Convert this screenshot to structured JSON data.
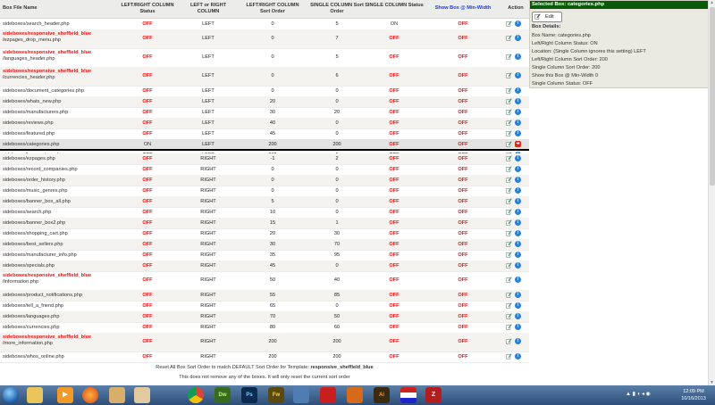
{
  "headers": {
    "file": "Box File Name",
    "lr_status": "LEFT/RIGHT COLUMN Status",
    "lr_column": "LEFT or RIGHT COLUMN",
    "lr_sort": "LEFT/RIGHT COLUMN Sort Order",
    "single_sort": "SINGLE COLUMN Sort Order",
    "single_status": "SINGLE COLUMN Status",
    "show_min": "Show Box @ Min-Width",
    "action": "Action"
  },
  "rows": [
    {
      "name": "sideboxes/search_header.php",
      "lr_status": "OFF",
      "column": "LEFT",
      "lr_sort": "0",
      "single_sort": "5",
      "single_status": "ON",
      "show": "OFF"
    },
    {
      "name_t1": "sideboxes/responsive_sheffield_blue",
      "name_t2": "/ezpages_drop_menu.php",
      "lr_status": "OFF",
      "column": "LEFT",
      "lr_sort": "0",
      "single_sort": "7",
      "single_status": "OFF",
      "show": "OFF"
    },
    {
      "name_t1": "sideboxes/responsive_sheffield_blue",
      "name_t2": "/languages_header.php",
      "lr_status": "OFF",
      "column": "LEFT",
      "lr_sort": "0",
      "single_sort": "5",
      "single_status": "OFF",
      "show": "OFF"
    },
    {
      "name_t1": "sideboxes/responsive_sheffield_blue",
      "name_t2": "/currencies_header.php",
      "lr_status": "OFF",
      "column": "LEFT",
      "lr_sort": "0",
      "single_sort": "6",
      "single_status": "OFF",
      "show": "OFF"
    },
    {
      "name": "sideboxes/document_categories.php",
      "lr_status": "OFF",
      "column": "LEFT",
      "lr_sort": "0",
      "single_sort": "0",
      "single_status": "OFF",
      "show": "OFF"
    },
    {
      "name": "sideboxes/whats_new.php",
      "lr_status": "OFF",
      "column": "LEFT",
      "lr_sort": "20",
      "single_sort": "0",
      "single_status": "OFF",
      "show": "OFF"
    },
    {
      "name": "sideboxes/manufacturers.php",
      "lr_status": "OFF",
      "column": "LEFT",
      "lr_sort": "30",
      "single_sort": "20",
      "single_status": "OFF",
      "show": "OFF"
    },
    {
      "name": "sideboxes/reviews.php",
      "lr_status": "OFF",
      "column": "LEFT",
      "lr_sort": "40",
      "single_sort": "0",
      "single_status": "OFF",
      "show": "OFF"
    },
    {
      "name": "sideboxes/featured.php",
      "lr_status": "OFF",
      "column": "LEFT",
      "lr_sort": "45",
      "single_sort": "0",
      "single_status": "OFF",
      "show": "OFF"
    },
    {
      "name": "sideboxes/categories.php",
      "lr_status": "ON",
      "column": "LEFT",
      "lr_sort": "200",
      "single_sort": "200",
      "single_status": "OFF",
      "show": "OFF",
      "selected": true
    },
    {
      "name": "sideboxes/banner_box.php",
      "lr_status": "OFF",
      "column": "LEFT",
      "lr_sort": "300",
      "single_sort": "1",
      "single_status": "OFF",
      "show": "OFF"
    },
    {
      "name": "sideboxes/ezpages.php",
      "lr_status": "OFF",
      "column": "RIGHT",
      "lr_sort": "-1",
      "single_sort": "2",
      "single_status": "OFF",
      "show": "OFF"
    },
    {
      "name": "sideboxes/record_companies.php",
      "lr_status": "OFF",
      "column": "RIGHT",
      "lr_sort": "0",
      "single_sort": "0",
      "single_status": "OFF",
      "show": "OFF"
    },
    {
      "name": "sideboxes/order_history.php",
      "lr_status": "OFF",
      "column": "RIGHT",
      "lr_sort": "0",
      "single_sort": "0",
      "single_status": "OFF",
      "show": "OFF"
    },
    {
      "name": "sideboxes/music_genres.php",
      "lr_status": "OFF",
      "column": "RIGHT",
      "lr_sort": "0",
      "single_sort": "0",
      "single_status": "OFF",
      "show": "OFF"
    },
    {
      "name": "sideboxes/banner_box_all.php",
      "lr_status": "OFF",
      "column": "RIGHT",
      "lr_sort": "5",
      "single_sort": "0",
      "single_status": "OFF",
      "show": "OFF"
    },
    {
      "name": "sideboxes/search.php",
      "lr_status": "OFF",
      "column": "RIGHT",
      "lr_sort": "10",
      "single_sort": "0",
      "single_status": "OFF",
      "show": "OFF"
    },
    {
      "name": "sideboxes/banner_box2.php",
      "lr_status": "OFF",
      "column": "RIGHT",
      "lr_sort": "15",
      "single_sort": "1",
      "single_status": "OFF",
      "show": "OFF"
    },
    {
      "name": "sideboxes/shopping_cart.php",
      "lr_status": "OFF",
      "column": "RIGHT",
      "lr_sort": "20",
      "single_sort": "30",
      "single_status": "OFF",
      "show": "OFF"
    },
    {
      "name": "sideboxes/best_sellers.php",
      "lr_status": "OFF",
      "column": "RIGHT",
      "lr_sort": "30",
      "single_sort": "70",
      "single_status": "OFF",
      "show": "OFF"
    },
    {
      "name": "sideboxes/manufacturer_info.php",
      "lr_status": "OFF",
      "column": "RIGHT",
      "lr_sort": "35",
      "single_sort": "95",
      "single_status": "OFF",
      "show": "OFF"
    },
    {
      "name": "sideboxes/specials.php",
      "lr_status": "OFF",
      "column": "RIGHT",
      "lr_sort": "45",
      "single_sort": "0",
      "single_status": "OFF",
      "show": "OFF"
    },
    {
      "name_t1": "sideboxes/responsive_sheffield_blue",
      "name_t2": "/information.php",
      "lr_status": "OFF",
      "column": "RIGHT",
      "lr_sort": "50",
      "single_sort": "40",
      "single_status": "OFF",
      "show": "OFF"
    },
    {
      "name": "sideboxes/product_notifications.php",
      "lr_status": "OFF",
      "column": "RIGHT",
      "lr_sort": "55",
      "single_sort": "85",
      "single_status": "OFF",
      "show": "OFF"
    },
    {
      "name": "sideboxes/tell_a_friend.php",
      "lr_status": "OFF",
      "column": "RIGHT",
      "lr_sort": "65",
      "single_sort": "0",
      "single_status": "OFF",
      "show": "OFF"
    },
    {
      "name": "sideboxes/languages.php",
      "lr_status": "OFF",
      "column": "RIGHT",
      "lr_sort": "70",
      "single_sort": "50",
      "single_status": "OFF",
      "show": "OFF"
    },
    {
      "name": "sideboxes/currencies.php",
      "lr_status": "OFF",
      "column": "RIGHT",
      "lr_sort": "80",
      "single_sort": "60",
      "single_status": "OFF",
      "show": "OFF"
    },
    {
      "name_t1": "sideboxes/responsive_sheffield_blue",
      "name_t2": "/more_information.php",
      "lr_status": "OFF",
      "column": "RIGHT",
      "lr_sort": "200",
      "single_sort": "200",
      "single_status": "OFF",
      "show": "OFF"
    },
    {
      "name": "sideboxes/whos_online.php",
      "lr_status": "OFF",
      "column": "RIGHT",
      "lr_sort": "200",
      "single_sort": "200",
      "single_status": "OFF",
      "show": "OFF"
    }
  ],
  "footer": {
    "reset_prefix": "Reset All Box Sort Order to match DEFAULT Sort Order for Template:",
    "template_name": "responsive_sheffield_blue",
    "note": "This does not remove any of the boxes. It will only reset the current sort order"
  },
  "panel": {
    "title": "Selected Box: categories.php",
    "edit_label": "Edit",
    "details_title": "Box Details:",
    "details": [
      "Box Name: categories.php",
      "Left/Right Column Status: ON",
      "Location: (Single Column ignores this setting) LEFT",
      "Left/Right Column Sort Order: 200",
      "Single Column Sort Order: 200",
      "Show this Box @ Min-Width 0",
      "Single Column Status: OFF"
    ]
  },
  "taskbar": {
    "apps": [
      "windows-explorer",
      "media-player",
      "firefox",
      "archive",
      "chrome",
      "dreamweaver",
      "photoshop",
      "fireworks",
      "explorer-folder",
      "acrobat",
      "bridge",
      "illustrator",
      "flag-app",
      "filezilla"
    ],
    "clock_time": "12:09 PM",
    "clock_date": "10/16/2013"
  },
  "colors": {
    "off": "#e81010",
    "selected_header": "#0a5a0a",
    "info_icon": "#2d7fd2"
  }
}
